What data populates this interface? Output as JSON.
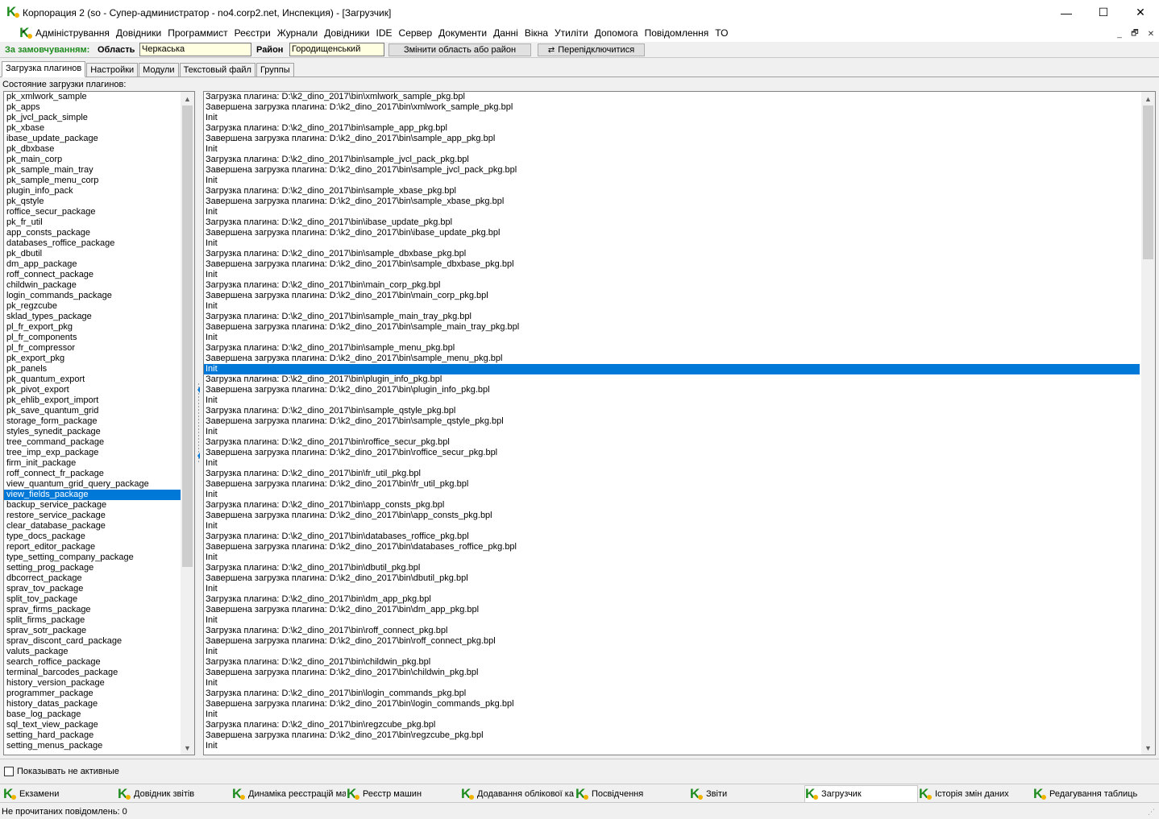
{
  "window": {
    "title": "Корпорация 2 (so - Супер-администратор - no4.corp2.net, Инспекция) - [Загрузчик]",
    "min_glyph": "—",
    "max_glyph": "☐",
    "close_glyph": "✕"
  },
  "menu": {
    "star": "*",
    "items": [
      "Адміністрування",
      "Довідники",
      "Программист",
      "Реєстри",
      "Журнали",
      "Довідники",
      "IDE",
      "Сервер",
      "Документи",
      "Данні",
      "Вікна",
      "Утиліти",
      "Допомога",
      "Повідомлення",
      "ТО"
    ],
    "mdi_min": "_",
    "mdi_restore": "🗗",
    "mdi_close": "✕"
  },
  "filter": {
    "order_label": "За замовчуванням:",
    "region_label": "Область",
    "region_value": "Черкаська",
    "district_label": "Район",
    "district_value": "Городищенський",
    "change_button": "Змінити область або район",
    "switch_button": "Перепідключитися"
  },
  "tabs": [
    "Загрузка плагинов",
    "Настройки",
    "Модули",
    "Текстовый файл",
    "Группы"
  ],
  "status_label": "Состояние загрузки плагинов:",
  "plugins": [
    "pk_xmlwork_sample",
    "pk_apps",
    "pk_jvcl_pack_simple",
    "pk_xbase",
    "ibase_update_package",
    "pk_dbxbase",
    "pk_main_corp",
    "pk_sample_main_tray",
    "pk_sample_menu_corp",
    "plugin_info_pack",
    "pk_qstyle",
    "roffice_secur_package",
    "pk_fr_util",
    "app_consts_package",
    "databases_roffice_package",
    "pk_dbutil",
    "dm_app_package",
    "roff_connect_package",
    "childwin_package",
    "login_commands_package",
    "pk_regzcube",
    "sklad_types_package",
    "pl_fr_export_pkg",
    "pl_fr_components",
    "pl_fr_compressor",
    "pk_export_pkg",
    "pk_panels",
    "pk_quantum_export",
    "pk_pivot_export",
    "pk_ehlib_export_import",
    "pk_save_quantum_grid",
    "storage_form_package",
    "styles_synedit_package",
    "tree_command_package",
    "tree_imp_exp_package",
    "firm_init_package",
    "roff_connect_fr_package",
    "view_quantum_grid_query_package",
    "view_fields_package",
    "backup_service_package",
    "restore_service_package",
    "clear_database_package",
    "type_docs_package",
    "report_editor_package",
    "type_setting_company_package",
    "setting_prog_package",
    "dbcorrect_package",
    "sprav_tov_package",
    "split_tov_package",
    "sprav_firms_package",
    "split_firms_package",
    "sprav_sotr_package",
    "sprav_discont_card_package",
    "valuts_package",
    "search_roffice_package",
    "terminal_barcodes_package",
    "history_version_package",
    "programmer_package",
    "history_datas_package",
    "base_log_package",
    "sql_text_view_package",
    "setting_hard_package",
    "setting_menus_package"
  ],
  "selected_plugin": "view_fields_package",
  "log_prefix_load": "Загрузка плагина: ",
  "log_prefix_done": "Завершена загрузка плагина: ",
  "log_init": "Init",
  "log_path": "D:\\k2_dino_2017\\bin\\",
  "log_files": [
    "xmlwork_sample_pkg.bpl",
    "sample_app_pkg.bpl",
    "sample_jvcl_pack_pkg.bpl",
    "sample_xbase_pkg.bpl",
    "ibase_update_pkg.bpl",
    "sample_dbxbase_pkg.bpl",
    "main_corp_pkg.bpl",
    "sample_main_tray_pkg.bpl",
    "sample_menu_pkg.bpl",
    "plugin_info_pkg.bpl",
    "sample_qstyle_pkg.bpl",
    "roffice_secur_pkg.bpl",
    "fr_util_pkg.bpl",
    "app_consts_pkg.bpl",
    "databases_roffice_pkg.bpl",
    "dbutil_pkg.bpl",
    "dm_app_pkg.bpl",
    "roff_connect_pkg.bpl",
    "childwin_pkg.bpl",
    "login_commands_pkg.bpl",
    "regzcube_pkg.bpl"
  ],
  "selected_log_row": 26,
  "scroll_up": "▲",
  "scroll_down": "▼",
  "show_inactive_label": "Показывать не активные",
  "tasks": [
    "Екзамени",
    "Довідник звітів",
    "Динаміка реєстрацій маш",
    "Реєстр машин",
    "Додавання облікової ка",
    "Посвідчення",
    "Звіти",
    "Загрузчик",
    "Історія змін даних",
    "Редагування таблиць"
  ],
  "active_task": "Загрузчик",
  "statusbar": "Не прочитаних повідомлень: 0",
  "colors": {
    "selection": "#0078d7",
    "input_bg": "#ffffe1",
    "logo_green": "#1e8c1e"
  }
}
